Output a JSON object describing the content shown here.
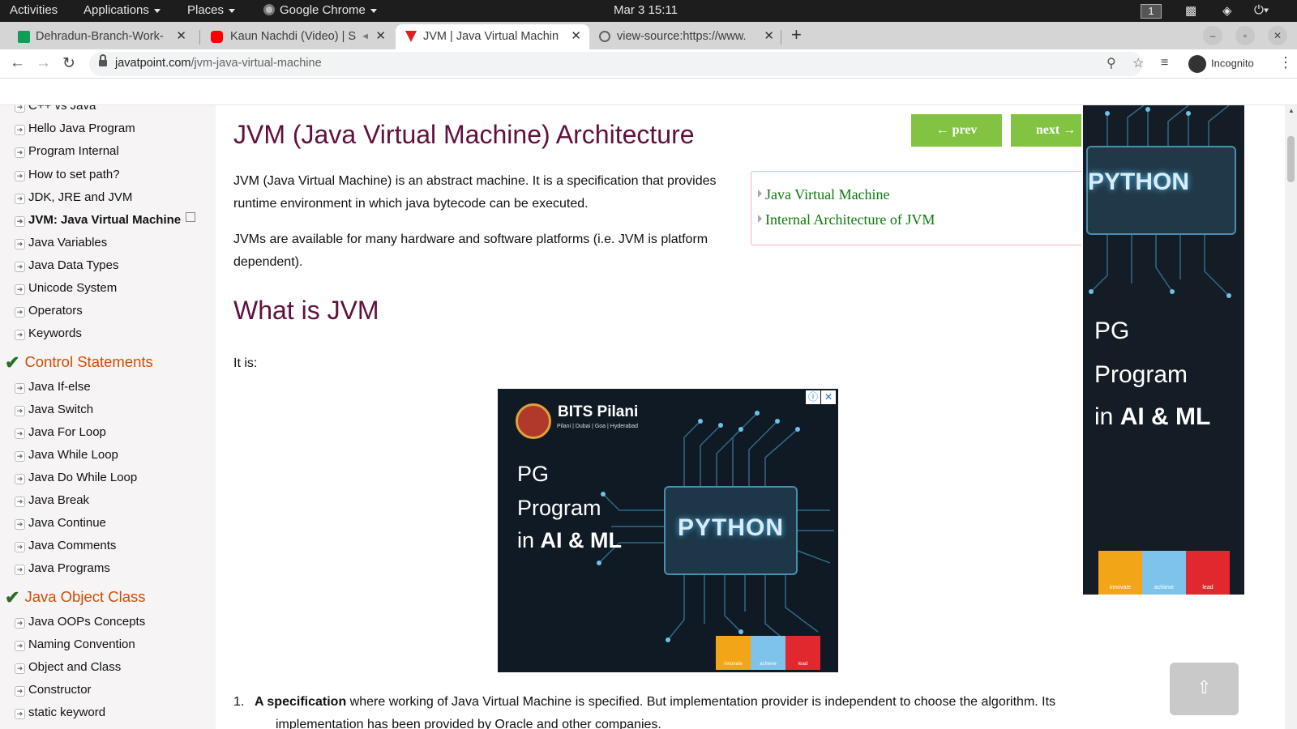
{
  "system_bar": {
    "activities": "Activities",
    "applications": "Applications",
    "places": "Places",
    "app_name": "Google Chrome",
    "datetime": "Mar 3  15:11",
    "workspace": "1"
  },
  "tabs": [
    {
      "title": "Dehradun-Branch-Work-",
      "favicon_color": "#0f9d58",
      "active": false
    },
    {
      "title": "Kaun Nachdi (Video) | S",
      "favicon_color": "#ff0000",
      "active": false
    },
    {
      "title": "JVM | Java Virtual Machin",
      "favicon_color": "#e01f1f",
      "active": true
    },
    {
      "title": "view-source:https://www.",
      "favicon_color": "#5f6368",
      "active": false
    }
  ],
  "address_bar": {
    "domain": "javatpoint.com",
    "path": "/jvm-java-virtual-machine",
    "profile": "Incognito"
  },
  "sidebar": {
    "items_top": [
      {
        "label": "C++ vs Java"
      },
      {
        "label": "Hello Java Program"
      },
      {
        "label": "Program Internal"
      },
      {
        "label": "How to set path?"
      },
      {
        "label": "JDK, JRE and JVM"
      },
      {
        "label": "JVM: Java Virtual Machine",
        "current": true
      },
      {
        "label": "Java Variables"
      },
      {
        "label": "Java Data Types"
      },
      {
        "label": "Unicode System"
      },
      {
        "label": "Operators"
      },
      {
        "label": "Keywords"
      }
    ],
    "section_control": "Control Statements",
    "items_control": [
      {
        "label": "Java If-else"
      },
      {
        "label": "Java Switch"
      },
      {
        "label": "Java For Loop"
      },
      {
        "label": "Java While Loop"
      },
      {
        "label": "Java Do While Loop"
      },
      {
        "label": "Java Break"
      },
      {
        "label": "Java Continue"
      },
      {
        "label": "Java Comments"
      },
      {
        "label": "Java Programs"
      }
    ],
    "section_object": "Java Object Class",
    "items_object": [
      {
        "label": "Java OOPs Concepts"
      },
      {
        "label": "Naming Convention"
      },
      {
        "label": "Object and Class"
      },
      {
        "label": "Constructor"
      },
      {
        "label": "static keyword"
      }
    ]
  },
  "main": {
    "title": "JVM (Java Virtual Machine) Architecture",
    "prev_label": "← prev",
    "next_label": "next →",
    "para1": "JVM (Java Virtual Machine) is an abstract machine. It is a specification that provides runtime environment in which java bytecode can be executed.",
    "para2": "JVMs are available for many hardware and software platforms (i.e. JVM is platform dependent).",
    "toc": [
      "Java Virtual Machine",
      "Internal Architecture of JVM"
    ],
    "h2": "What is JVM",
    "it_is": "It is:",
    "list_num": "1.",
    "list_bold": "A specification",
    "list_rest": " where working of Java Virtual Machine is specified. But implementation provider is independent to choose the algorithm. Its",
    "list_line2": "implementation has been provided by Oracle and other companies."
  },
  "ad_center": {
    "brand": "BITS Pilani",
    "brand_sub": "Pilani | Dubai | Goa | Hyderabad",
    "line1": "PG",
    "line2": "Program",
    "line3_pre": "in ",
    "line3_bold": "AI & ML",
    "python": "PYTHON",
    "tiles": [
      "innovate",
      "achieve",
      "lead"
    ]
  },
  "ad_right": {
    "python": "PYTHON",
    "line1": "PG",
    "line2": "Program",
    "line3_pre": "in ",
    "line3_bold": "AI & ML",
    "tiles": [
      "innovate",
      "achieve",
      "lead"
    ]
  },
  "colors": {
    "heading": "#61103d",
    "section": "#d24c04",
    "nav_button": "#82c341",
    "toc_link": "#0a7a0a"
  }
}
